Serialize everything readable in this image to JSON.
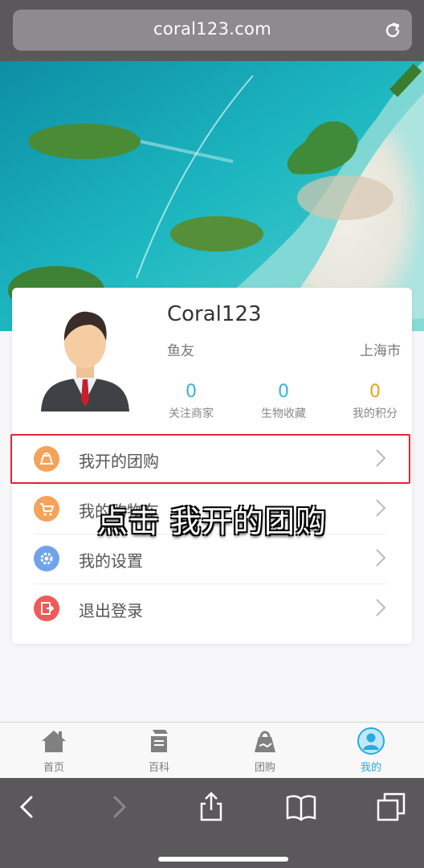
{
  "browser": {
    "url": "coral123.com",
    "reload_icon": "reload-icon"
  },
  "profile": {
    "username": "Coral123",
    "role": "鱼友",
    "city": "上海市",
    "stats": [
      {
        "value": "0",
        "label": "关注商家",
        "color": "#36b2e6"
      },
      {
        "value": "0",
        "label": "生物收藏",
        "color": "#36b2e6"
      },
      {
        "value": "0",
        "label": "我的积分",
        "color": "#f0a020"
      }
    ]
  },
  "menu": [
    {
      "label": "我开的团购",
      "icon": "group-buy-icon",
      "color": "#f5a35a"
    },
    {
      "label": "我的购物车",
      "icon": "cart-icon",
      "color": "#f5a35a"
    },
    {
      "label": "我的设置",
      "icon": "gear-icon",
      "color": "#6fa4ea"
    },
    {
      "label": "退出登录",
      "icon": "logout-icon",
      "color": "#ef5a5a"
    }
  ],
  "caption": "点击 我开的团购",
  "tabs": [
    {
      "label": "首页",
      "icon": "home-icon"
    },
    {
      "label": "百科",
      "icon": "encyclopedia-icon"
    },
    {
      "label": "团购",
      "icon": "group-buy-bag-icon"
    },
    {
      "label": "我的",
      "icon": "profile-icon",
      "active": true
    }
  ],
  "colors": {
    "accent": "#2aa9e0",
    "highlight": "#e02636",
    "browser_chrome": "#5a585a"
  }
}
